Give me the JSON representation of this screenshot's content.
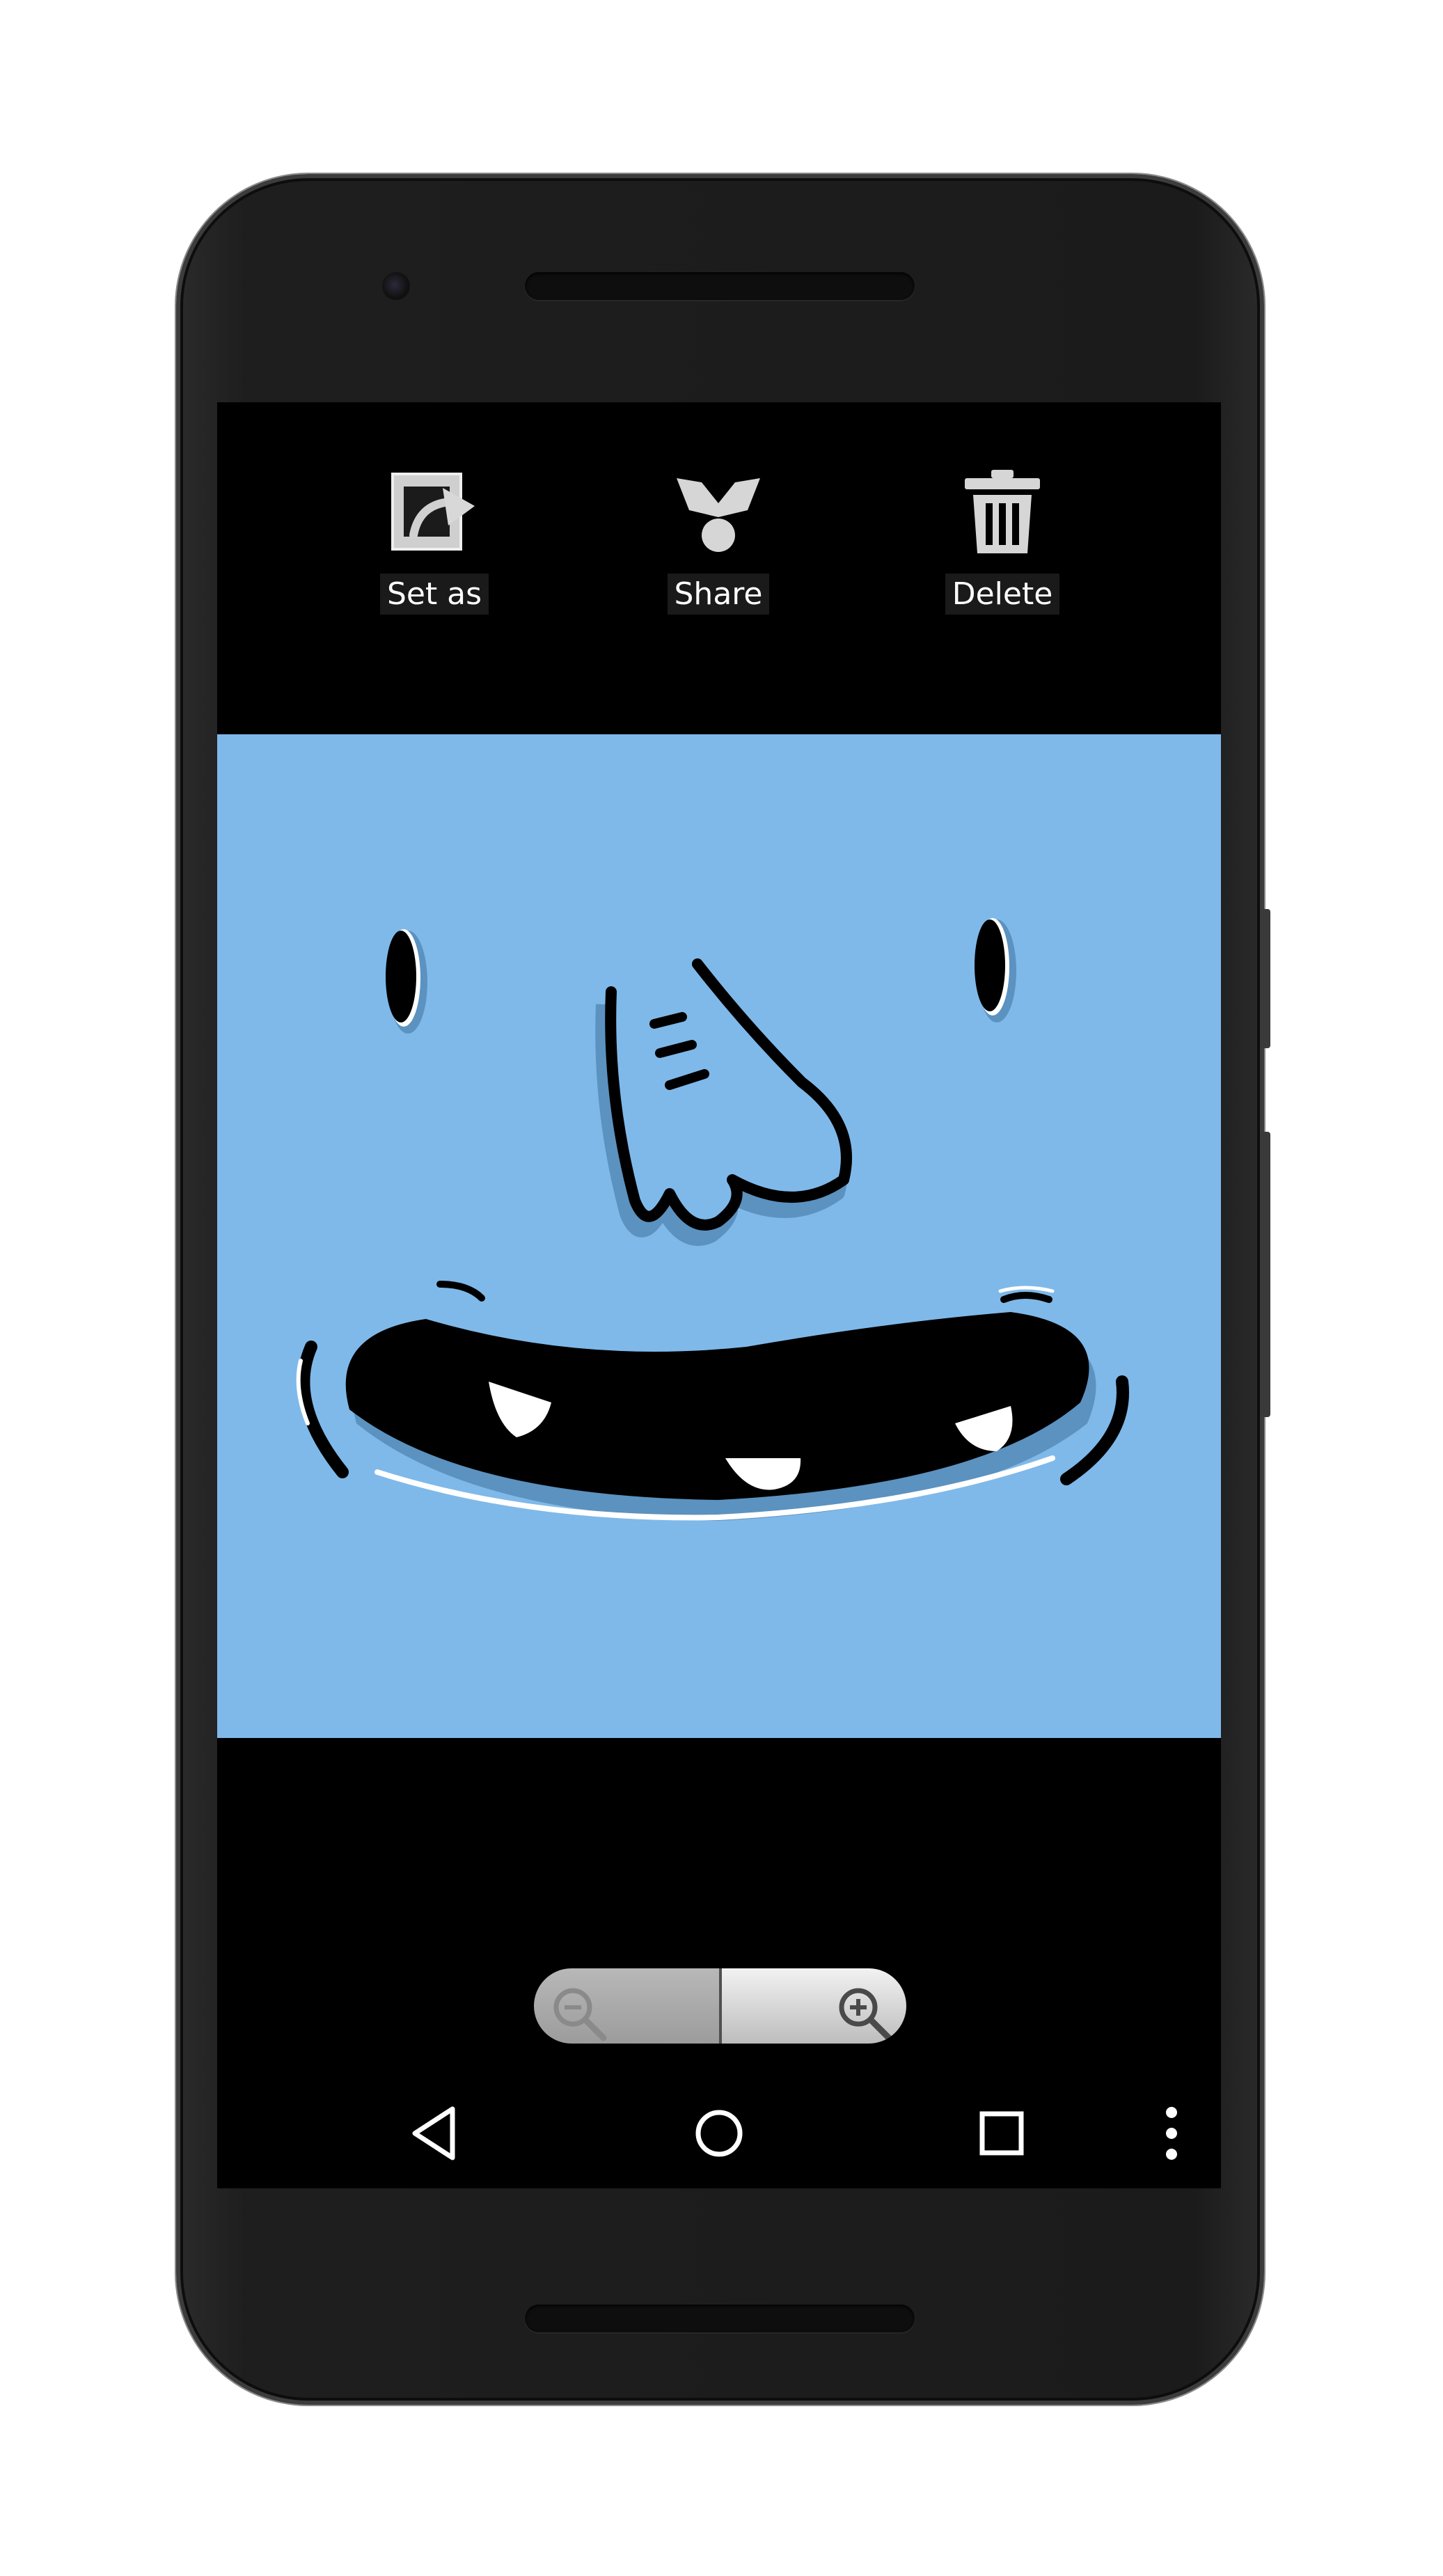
{
  "toolbar": {
    "actions": [
      {
        "label": "Set as",
        "icon": "set-as-icon"
      },
      {
        "label": "Share",
        "icon": "share-icon"
      },
      {
        "label": "Delete",
        "icon": "trash-icon"
      }
    ]
  },
  "photo": {
    "subject": "blue-face-illustration",
    "background_color": "#7fb9ea"
  },
  "zoom": {
    "out_icon": "zoom-out-icon",
    "in_icon": "zoom-in-icon"
  },
  "navigation": {
    "back_icon": "back-icon",
    "home_icon": "home-icon",
    "recents_icon": "recents-icon",
    "menu_icon": "overflow-menu-icon"
  },
  "colors": {
    "screen_bg": "#000000",
    "label_text": "#ffffff",
    "icon_gray": "#d6d6d6"
  }
}
